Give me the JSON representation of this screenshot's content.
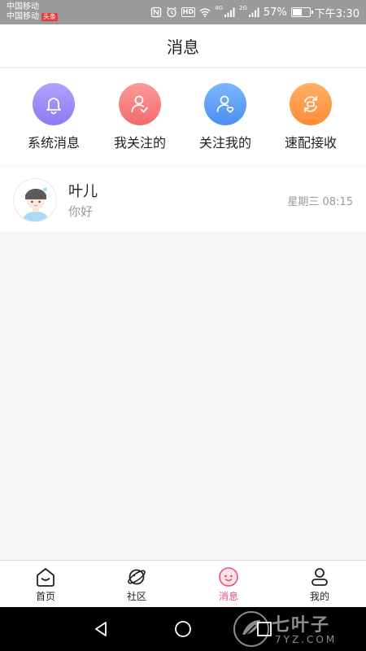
{
  "status_bar": {
    "carrier_1": "中国移动",
    "carrier_2": "中国移动",
    "news_badge": "头条",
    "hd_badge": "HD",
    "net_1": "4G",
    "net_2": "2G",
    "battery_text": "57%",
    "battery_level": 0.57,
    "time": "下午3:30"
  },
  "header": {
    "title": "消息"
  },
  "shortcuts": [
    {
      "label": "系统消息",
      "icon": "bell-icon",
      "color_from": "#b2a1ff",
      "color_to": "#8d79f2"
    },
    {
      "label": "我关注的",
      "icon": "user-check-icon",
      "color_from": "#ff9a9a",
      "color_to": "#f26b6b"
    },
    {
      "label": "关注我的",
      "icon": "user-heart-icon",
      "color_from": "#7ab8ff",
      "color_to": "#4b8ff0"
    },
    {
      "label": "速配接收",
      "icon": "swap-icon",
      "color_from": "#ffb066",
      "color_to": "#fb8d37"
    }
  ],
  "messages": [
    {
      "name": "叶儿",
      "preview": "你好",
      "time": "星期三 08:15",
      "avatar": "girl-avatar"
    }
  ],
  "tabs": [
    {
      "label": "首页",
      "icon": "home-icon",
      "active": false
    },
    {
      "label": "社区",
      "icon": "planet-icon",
      "active": false
    },
    {
      "label": "消息",
      "icon": "message-face-icon",
      "active": true
    },
    {
      "label": "我的",
      "icon": "profile-icon",
      "active": false
    }
  ],
  "watermark": {
    "big": "七叶子",
    "small": "7YZ.COM"
  },
  "colors": {
    "accent": "#ef4a7a",
    "status_bar": "#9a9a9a"
  }
}
